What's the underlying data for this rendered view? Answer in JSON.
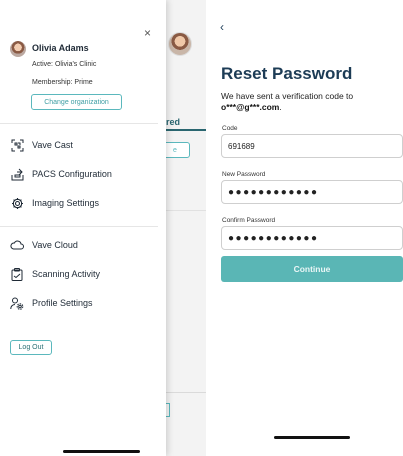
{
  "drawer": {
    "user_name": "Olivia Adams",
    "active_label": "Active:",
    "active_value": "Olivia's Clinic",
    "membership_label": "Membership:",
    "membership_value": "Prime",
    "change_org_label": "Change organization",
    "close_glyph": "×",
    "nav_group_1": [
      {
        "label": "Vave Cast",
        "icon": "scan-cast-icon"
      },
      {
        "label": "PACS Configuration",
        "icon": "upload-tray-icon"
      },
      {
        "label": "Imaging Settings",
        "icon": "gear-icon"
      }
    ],
    "nav_group_2": [
      {
        "label": "Vave Cloud",
        "icon": "cloud-icon"
      },
      {
        "label": "Scanning Activity",
        "icon": "clipboard-icon"
      },
      {
        "label": "Profile Settings",
        "icon": "person-gear-icon"
      }
    ],
    "logout_label": "Log Out"
  },
  "underlay": {
    "tab_fragment": "red",
    "button_fragment": "e",
    "footer_fragment": "s"
  },
  "reset": {
    "back_glyph": "‹",
    "title": "Reset Password",
    "subtitle_line1": "We have sent a verification code to",
    "subtitle_email": "o***@g***.com",
    "subtitle_period": ".",
    "code_label": "Code",
    "code_value": "691689",
    "new_password_label": "New Password",
    "new_password_value": "●●●●●●●●●●●●",
    "confirm_password_label": "Confirm Password",
    "confirm_password_value": "●●●●●●●●●●●●",
    "continue_label": "Continue"
  },
  "colors": {
    "accent_teal": "#5ab6b5",
    "title_navy": "#1d3c56"
  }
}
